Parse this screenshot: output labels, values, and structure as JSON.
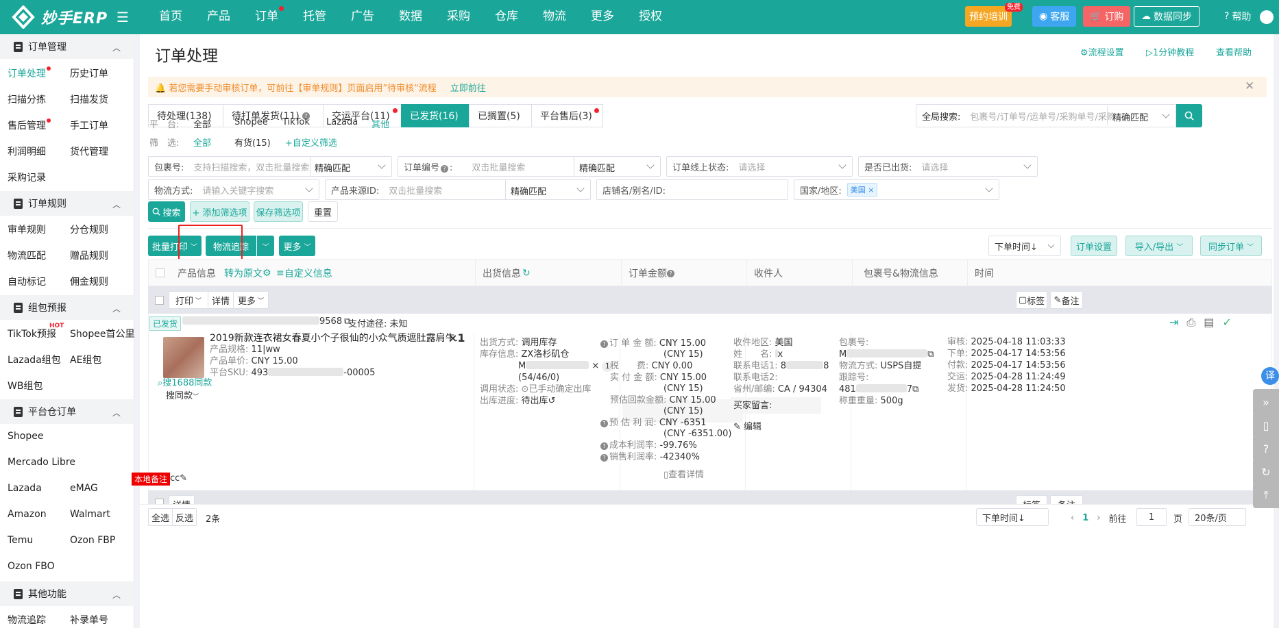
{
  "brand": {
    "name": "妙手ERP",
    "accent": "#1aa79a"
  },
  "nav": [
    "首页",
    "产品",
    "订单",
    "托管",
    "广告",
    "数据",
    "采购",
    "仓库",
    "物流",
    "更多",
    "授权"
  ],
  "topright": {
    "training": "预约培训",
    "free": "免费",
    "service": "客服",
    "subscribe": "订购",
    "sync": "数据同步",
    "help": "帮助"
  },
  "sidebar": {
    "s1": {
      "title": "订单管理",
      "items": [
        "订单处理",
        "历史订单",
        "扫描分拣",
        "扫描发货",
        "售后管理",
        "手工订单",
        "利润明细",
        "货代管理",
        "采购记录"
      ]
    },
    "s2": {
      "title": "订单规则",
      "items": [
        "审单规则",
        "分仓规则",
        "物流匹配",
        "赠品规则",
        "自动标记",
        "佣金规则"
      ]
    },
    "s3": {
      "title": "组包预报",
      "items": [
        "TikTok预报",
        "Shopee首公里",
        "Lazada组包",
        "AE组包",
        "WB组包"
      ],
      "hot": "HOT"
    },
    "s4": {
      "title": "平台仓订单",
      "items": [
        "Shopee",
        "Mercado Libre",
        "Lazada",
        "eMAG",
        "Amazon",
        "Walmart",
        "Temu",
        "Ozon FBP",
        "Ozon FBO"
      ]
    },
    "s5": {
      "title": "其他功能",
      "items": [
        "物流追踪",
        "补录单号"
      ]
    }
  },
  "page": {
    "title": "订单处理",
    "flow": "流程设置",
    "tutorial": "1分钟教程",
    "help": "查看帮助"
  },
  "notice": {
    "text": "若您需要手动审核订单，可前往【审单规则】页面启用”待审核“流程",
    "link": "立即前往"
  },
  "tabs": [
    "待处理(138)",
    "待打单发货(11)",
    "交运平台(11)",
    "已发货(16)",
    "已搁置(5)",
    "平台售后(3)"
  ],
  "search": {
    "label": "全局搜索:",
    "placeholder": "包裹号/订单号/运单号/采购单号/采购物流单号",
    "match": "精确匹配"
  },
  "platform": {
    "label": "平　台:",
    "options": [
      "全部",
      "Shopee",
      "TikTok",
      "Lazada",
      "其他"
    ]
  },
  "filter": {
    "label": "筛　选:",
    "options": [
      "全部",
      "有货(15)",
      "+自定义筛选"
    ]
  },
  "fields": {
    "pkg": {
      "label": "包裹号:",
      "ph": "支持扫描搜索，双击批量搜索",
      "match": "精确匹配"
    },
    "order": {
      "label": "订单编号",
      "ph": "双击批量搜索",
      "match": "精确匹配"
    },
    "online": {
      "label": "订单线上状态:",
      "ph": "请选择"
    },
    "out": {
      "label": "是否已出货:",
      "ph": "请选择"
    },
    "logi": {
      "label": "物流方式:",
      "ph": "请输入关键字搜索"
    },
    "src": {
      "label": "产品来源ID:",
      "ph": "双击批量搜索",
      "match": "精确匹配"
    },
    "shop": {
      "label": "店铺名/别名/ID:"
    },
    "country": {
      "label": "国家/地区:",
      "tag": "美国"
    }
  },
  "actions": {
    "search": "搜索",
    "add": "+ 添加筛选项",
    "save": "保存筛选项",
    "reset": "重置",
    "print": "批量打印",
    "track": "物流追踪",
    "more": "更多",
    "sort": "下单时间↓",
    "settings": "订单设置",
    "io": "导入/导出",
    "syncorder": "同步订单"
  },
  "cols": {
    "product": "产品信息",
    "translate": "转为原文",
    "custom": "自定义信息",
    "ship": "出货信息",
    "amount": "订单金额",
    "recv": "收件人",
    "pkg": "包裹号&物流信息",
    "time": "时间"
  },
  "bar": {
    "print": "打印",
    "detail": "详情",
    "more": "更多",
    "label": "标签",
    "note": "备注"
  },
  "order": {
    "status": "已发货",
    "idtail": "9568",
    "pay": "支付途径: 未知",
    "title": "2019新款连衣裙女春夏小个子很仙的小众气质遮肚露肩牛...",
    "qty": "×1",
    "spec": "11|ww",
    "specl": "产品规格:",
    "price": "CNY 15.00",
    "pricel": "产品单价:",
    "skul": "平台SKU:",
    "skua": "493",
    "skub": "-00005",
    "find": "搜1688同款",
    "similar": "搜同款",
    "shipmethod": "调用库存",
    "shipmethodl": "出货方式:",
    "wh": "ZX洛杉矶仓",
    "whl": "库存信息:",
    "ms": "M",
    "stk": "(54/46/0)",
    "one": "1",
    "callst": "已手动确定出库",
    "callstl": "调用状态:",
    "prog": "待出库",
    "progl": "出库进度:",
    "amt": [
      {
        "l": "订 单 金 额:",
        "v": "CNY 15.00",
        "s": "(CNY 15)"
      },
      {
        "l": "税　　费:",
        "v": "CNY 0.00"
      },
      {
        "l": "实 付 金 额:",
        "v": "CNY 15.00",
        "s": "(CNY 15)"
      },
      {
        "l": "预估回款金额:",
        "v": "CNY 15.00",
        "s": "(CNY 15)"
      },
      {
        "l": "预 估 利 润:",
        "v": "CNY -6351",
        "s": "(CNY -6351.00)"
      },
      {
        "l": "成本利润率:",
        "v": "-99.76%"
      },
      {
        "l": "销售利润率:",
        "v": "-42340%"
      }
    ],
    "viewdetail": "查看详情",
    "recv": {
      "areal": "收件地区:",
      "area": "美国",
      "namel": "姓　　名:",
      "name": "x",
      "t1l": "联系电话1:",
      "t1a": "8",
      "t1b": "8",
      "t2l": "联系电话2:",
      "zipl": "省州/邮编:",
      "zip": "CA / 94304",
      "msgl": "买家留言:",
      "edit": "编辑"
    },
    "pk": {
      "pkgl": "包裹号:",
      "pkg": "M",
      "lml": "物流方式:",
      "lm": "USPS自提",
      "trl": "跟踪号:",
      "tra": "481",
      "trb": "7",
      "wl": "称重重量:",
      "w": "500g"
    },
    "times": [
      {
        "l": "审核:",
        "v": "2025-04-18 11:03:33"
      },
      {
        "l": "下单:",
        "v": "2025-04-17 14:53:56"
      },
      {
        "l": "付款:",
        "v": "2025-04-17 14:53:56"
      },
      {
        "l": "交运:",
        "v": "2025-04-28 11:24:49"
      },
      {
        "l": "发货:",
        "v": "2025-04-28 11:24:50"
      }
    ],
    "notel": "本地备注",
    "note": "cc"
  },
  "footer": {
    "all": "全选",
    "inv": "反选",
    "count": "2条",
    "sort": "下单时间↓",
    "page": "1",
    "goto": "前往",
    "gotoval": "1",
    "pageunit": "页",
    "size": "20条/页"
  },
  "float": {
    "translate": "译"
  }
}
